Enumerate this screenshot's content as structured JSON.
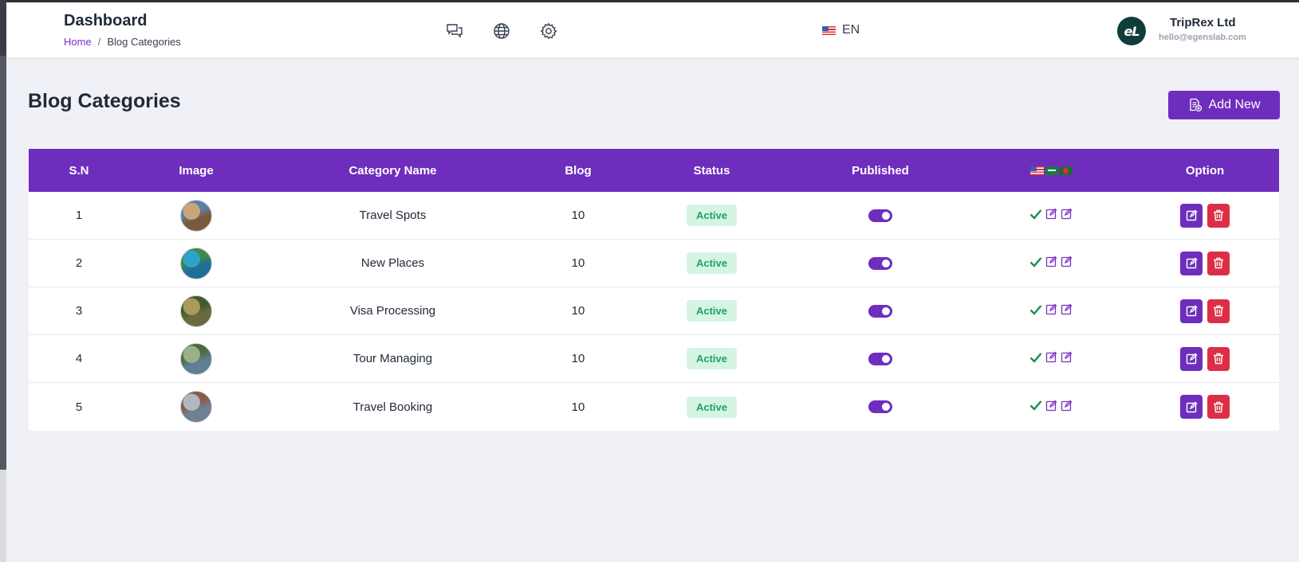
{
  "header": {
    "title": "Dashboard",
    "breadcrumb": {
      "home": "Home",
      "separator": "/",
      "current": "Blog Categories"
    },
    "icons": [
      "chat-icon",
      "globe-icon",
      "gear-icon"
    ],
    "language": {
      "code": "EN",
      "flag": "us-flag-icon"
    },
    "user": {
      "avatar_text": "eL",
      "company": "TripRex Ltd",
      "email": "hello@egenslab.com"
    }
  },
  "page": {
    "title": "Blog Categories",
    "add_button": "Add New"
  },
  "table": {
    "columns": [
      "S.N",
      "Image",
      "Category Name",
      "Blog",
      "Status",
      "Published",
      "",
      "Option"
    ],
    "language_flags": [
      "us-flag-icon",
      "sa-flag-icon",
      "bd-flag-icon"
    ],
    "rows": [
      {
        "sn": "1",
        "image": "travel-spots-thumbnail",
        "name": "Travel Spots",
        "blog": "10",
        "status": "Active",
        "published": true
      },
      {
        "sn": "2",
        "image": "new-places-thumbnail",
        "name": "New Places",
        "blog": "10",
        "status": "Active",
        "published": true
      },
      {
        "sn": "3",
        "image": "visa-processing-thumbnail",
        "name": "Visa Processing",
        "blog": "10",
        "status": "Active",
        "published": true
      },
      {
        "sn": "4",
        "image": "tour-managing-thumbnail",
        "name": "Tour Managing",
        "blog": "10",
        "status": "Active",
        "published": true
      },
      {
        "sn": "5",
        "image": "travel-booking-thumbnail",
        "name": "Travel Booking",
        "blog": "10",
        "status": "Active",
        "published": true
      }
    ]
  },
  "colors": {
    "primary": "#6f2dbd",
    "danger": "#dc2f45",
    "active_badge_bg": "#d6f4e4",
    "active_badge_text": "#1aa561",
    "background": "#f0f1f6"
  }
}
